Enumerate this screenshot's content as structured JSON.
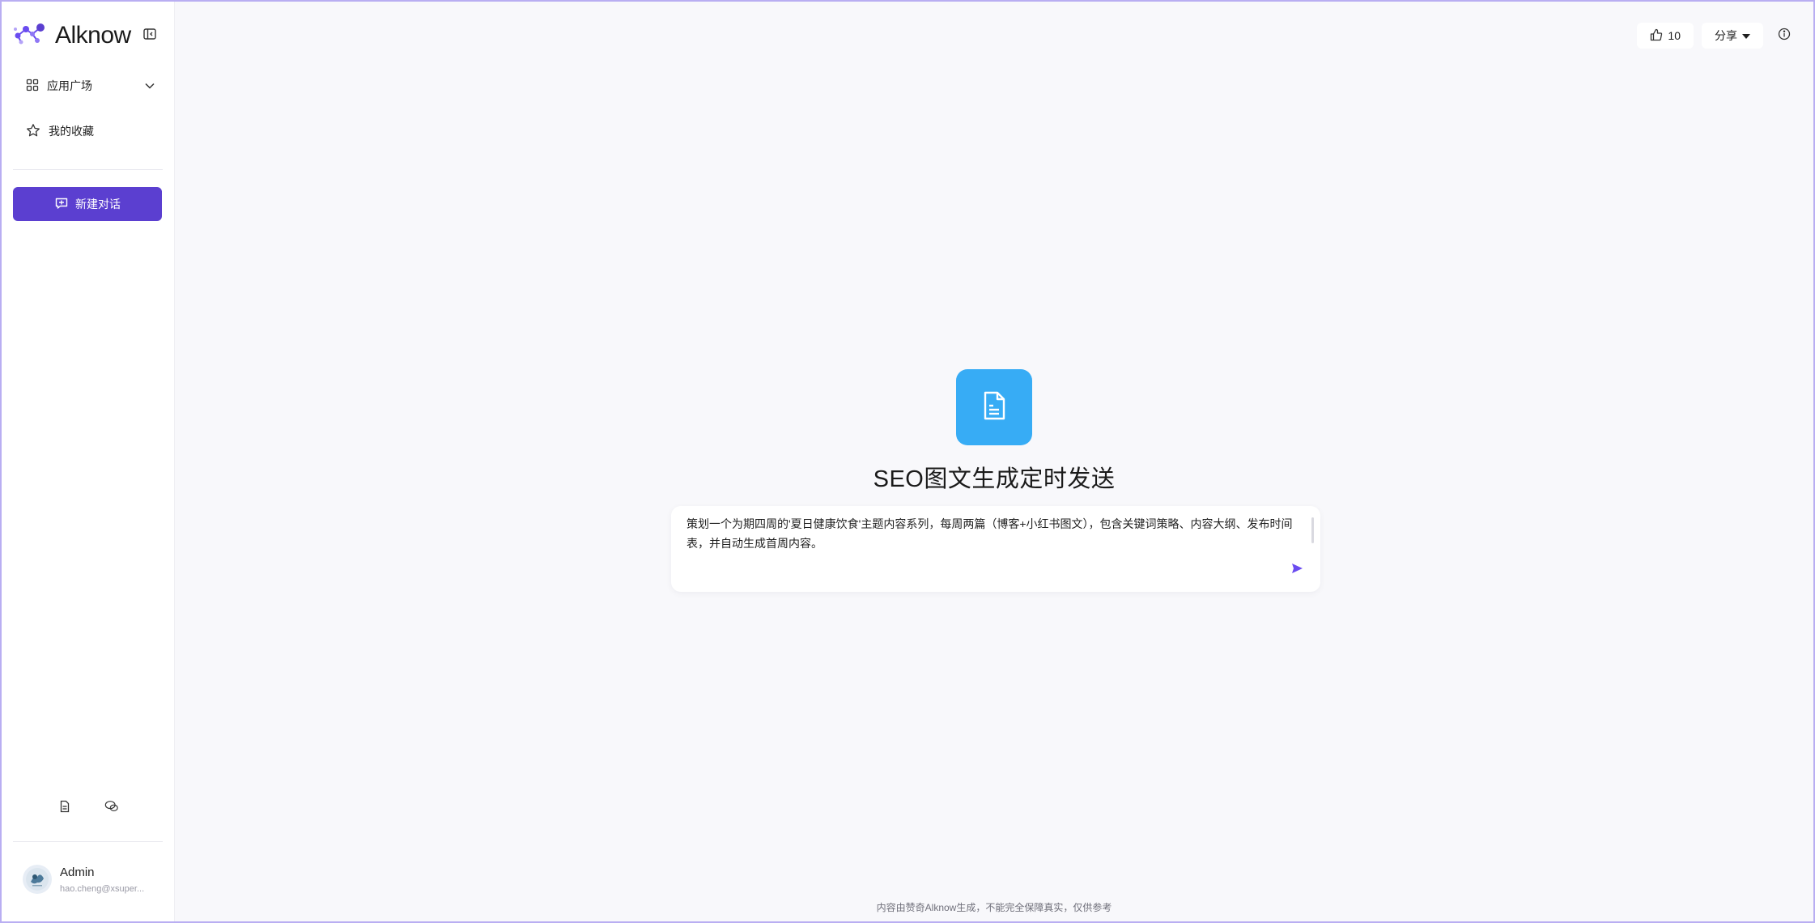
{
  "brand": {
    "name": "Alknow"
  },
  "sidebar": {
    "app_market": "应用广场",
    "favorites": "我的收藏",
    "new_chat": "新建对话"
  },
  "user": {
    "name": "Admin",
    "email": "hao.cheng@xsuper..."
  },
  "header": {
    "like_count": "10",
    "share_label": "分享"
  },
  "app": {
    "title": "SEO图文生成定时发送",
    "icon_color": "#37acf5"
  },
  "composer": {
    "value": "策划一个为期四周的'夏日健康饮食'主题内容系列，每周两篇（博客+小红书图文），包含关键词策略、内容大纲、发布时间表，并自动生成首周内容。"
  },
  "footer": {
    "disclaimer": "内容由赞奇Alknow生成，不能完全保障真实，仅供参考"
  },
  "colors": {
    "accent": "#5b3fd0",
    "brand_purple": "#6a4cf0",
    "background": "#f8f8fb"
  },
  "icons": {
    "brand_logo": "molecule-logo-icon",
    "collapse": "sidebar-collapse-icon",
    "app_market": "grid-icon",
    "favorites": "star-icon",
    "new_chat": "chat-plus-icon",
    "doc": "document-icon",
    "wechat": "wechat-icon",
    "like": "thumbs-up-icon",
    "share_caret": "caret-down-icon",
    "info": "info-icon",
    "send": "send-icon"
  }
}
